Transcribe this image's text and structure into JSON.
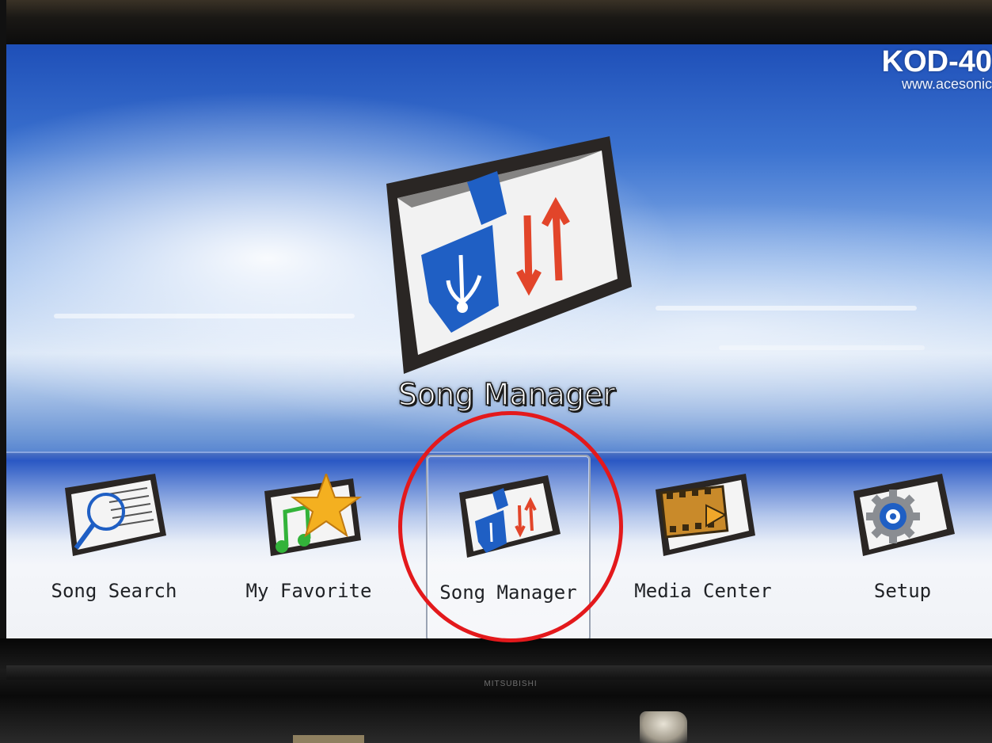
{
  "tv": {
    "brand": "MITSUBISHI"
  },
  "header": {
    "model": "KOD-40",
    "website": "www.acesonic"
  },
  "featured": {
    "title": "Song Manager",
    "icon": "usb-transfer-icon"
  },
  "menu": {
    "items": [
      {
        "label": "Song Search",
        "icon": "magnifier-icon",
        "selected": false
      },
      {
        "label": "My Favorite",
        "icon": "star-music-note-icon",
        "selected": false
      },
      {
        "label": "Song Manager",
        "icon": "usb-transfer-icon",
        "selected": true
      },
      {
        "label": "Media Center",
        "icon": "film-strip-play-icon",
        "selected": false
      },
      {
        "label": "Setup",
        "icon": "gear-icon",
        "selected": false
      }
    ]
  },
  "annotation": {
    "color": "#e3191c"
  },
  "colors": {
    "usb_blue": "#1f5fc4",
    "arrow_red": "#e2452a",
    "star_gold": "#f4b020"
  }
}
